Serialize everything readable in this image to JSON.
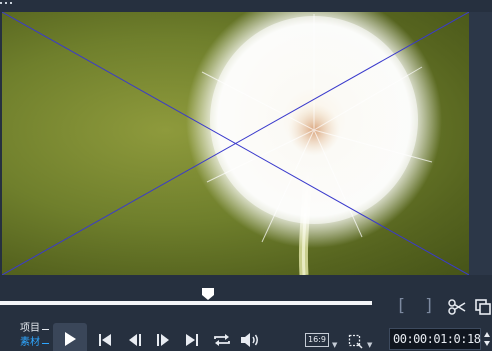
{
  "player": {
    "preview_subject": "dandelion-seed-head",
    "scrubber_position": 0.56
  },
  "mode": {
    "project_label": "项目",
    "clip_label": "素材",
    "active": "clip"
  },
  "controls": {
    "aspect_ratio": "16:9",
    "timecode": "00:00:01:0:18"
  },
  "colors": {
    "background": "#26303f",
    "scrubber": "#f3f5f8",
    "active_mode": "#2ea6ff",
    "guide_lines": "#3a3acc"
  },
  "icons": [
    "mark-in-icon",
    "mark-out-icon",
    "cut-icon",
    "copy-icon",
    "play-icon",
    "go-to-start-icon",
    "previous-frame-icon",
    "next-frame-icon",
    "go-to-end-icon",
    "repeat-icon",
    "volume-icon",
    "chevron-down-icon",
    "crop-icon"
  ]
}
